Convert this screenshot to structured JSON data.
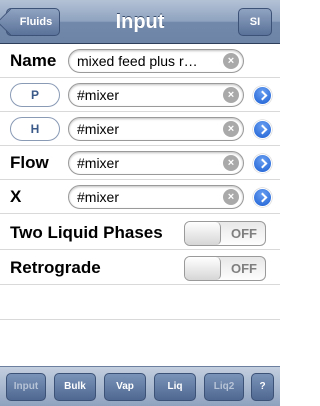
{
  "navbar": {
    "back_label": "Fluids",
    "title": "Input",
    "unit_label": "SI"
  },
  "rows": {
    "name": {
      "label": "Name",
      "value": "mixed feed plus r…"
    },
    "p": {
      "label": "P",
      "value": "#mixer"
    },
    "h": {
      "label": "H",
      "value": "#mixer"
    },
    "flow": {
      "label": "Flow",
      "value": "#mixer"
    },
    "x": {
      "label": "X",
      "value": "#mixer"
    },
    "two_liquid": {
      "label": "Two Liquid Phases",
      "state": "OFF"
    },
    "retrograde": {
      "label": "Retrograde",
      "state": "OFF"
    }
  },
  "tabs": [
    "Input",
    "Bulk",
    "Vap",
    "Liq",
    "Liq2",
    "?"
  ],
  "icons": {
    "clear": "clear-x-icon",
    "disclosure": "blue-chevron-disclosure-icon"
  }
}
